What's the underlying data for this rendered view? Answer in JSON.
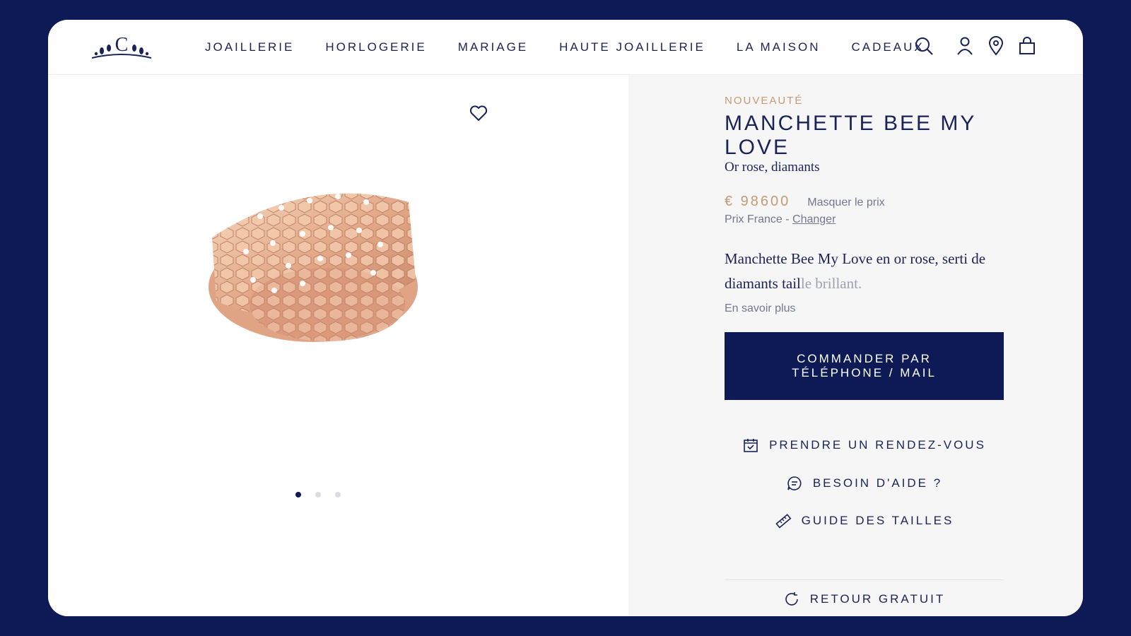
{
  "header": {
    "nav": [
      "JOAILLERIE",
      "HORLOGERIE",
      "MARIAGE",
      "HAUTE JOAILLERIE",
      "LA MAISON",
      "CADEAUX"
    ],
    "icons": [
      "search-icon",
      "account-icon",
      "location-icon",
      "bag-icon"
    ]
  },
  "gallery": {
    "image_count": 3,
    "active_index": 0,
    "icons": [
      "heart-icon"
    ]
  },
  "product": {
    "badge": "NOUVEAUTÉ",
    "title": "MANCHETTE BEE MY LOVE",
    "subtitle": "Or rose, diamants",
    "price": "€ 98600",
    "hide_price": "Masquer le prix",
    "country_prefix": "Prix France - ",
    "change_link": "Changer",
    "description_main": "Manchette Bee My Love en or rose, serti de diamants tail",
    "description_fade": "le brillant.",
    "more_link": "En savoir plus",
    "order_button": "COMMANDER PAR\nTÉLÉPHONE / MAIL"
  },
  "actions": [
    {
      "label": "PRENDRE UN RENDEZ-VOUS",
      "icon": "calendar-icon"
    },
    {
      "label": "BESOIN D'AIDE ?",
      "icon": "chat-icon"
    },
    {
      "label": "GUIDE DES TAILLES",
      "icon": "ruler-icon"
    },
    {
      "label": "RETOUR GRATUIT",
      "icon": "return-icon"
    }
  ],
  "colors": {
    "navy": "#0e1a55",
    "gold": "#c69a73",
    "panel": "#f6f6f7"
  }
}
